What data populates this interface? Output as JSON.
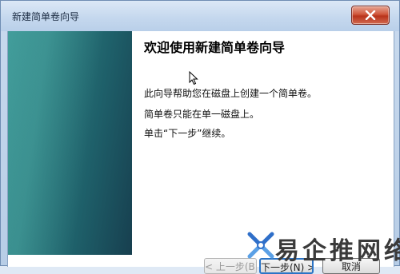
{
  "window": {
    "title": "新建简单卷向导"
  },
  "wizard": {
    "heading": "欢迎使用新建简单卷向导",
    "line1": "此向导帮助您在磁盘上创建一个简单卷。",
    "line2": "简单卷只能在单一磁盘上。",
    "line3": "单击“下一步”继续。"
  },
  "buttons": {
    "back": "< 上一步(B)",
    "next": "下一步(N) >",
    "cancel": "取消"
  },
  "watermark": {
    "text": "易企推网络"
  },
  "icons": {
    "close": "close-icon",
    "cursor": "mouse-pointer-icon",
    "logo": "watermark-logo-icon"
  },
  "colors": {
    "side_panel": "#2d7e80",
    "close_button": "#c9432a",
    "focus_border": "#2b74c6"
  }
}
